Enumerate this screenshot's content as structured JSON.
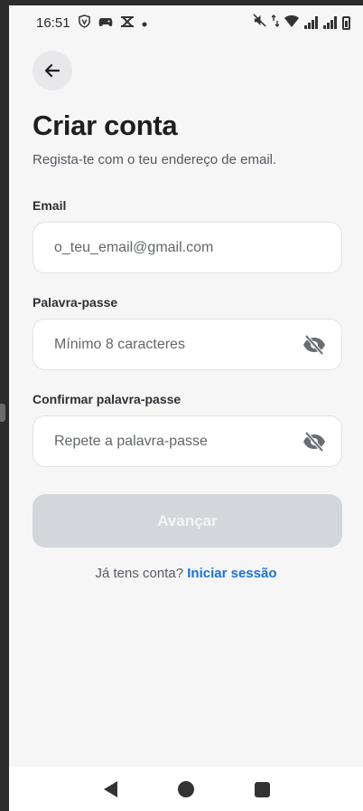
{
  "status_bar": {
    "time": "16:51",
    "left_icons": [
      "vpn-shield-icon",
      "game-controller-icon",
      "capcut-icon",
      "dot-icon"
    ],
    "right_icons": [
      "mute-icon",
      "wifi-icon",
      "signal-icon",
      "signal-icon",
      "battery-icon"
    ]
  },
  "header": {
    "back_icon": "arrow-left-icon",
    "title": "Criar conta",
    "subtitle": "Regista-te com o teu endereço de email."
  },
  "form": {
    "email": {
      "label": "Email",
      "placeholder": "o_teu_email@gmail.com",
      "value": ""
    },
    "password": {
      "label": "Palavra-passe",
      "placeholder": "Mínimo 8 caracteres",
      "value": "",
      "toggle_icon": "eye-off-icon"
    },
    "confirm_password": {
      "label": "Confirmar palavra-passe",
      "placeholder": "Repete a palavra-passe",
      "value": "",
      "toggle_icon": "eye-off-icon"
    },
    "submit_label": "Avançar",
    "submit_enabled": false
  },
  "footer": {
    "prompt": "Já tens conta?",
    "link": "Iniciar sessão"
  },
  "colors": {
    "accent": "#1a73d9",
    "button_disabled": "#d3d6db",
    "background": "#f6f6f7"
  },
  "nav_bar": {
    "icons": [
      "nav-back-icon",
      "nav-home-icon",
      "nav-recents-icon"
    ]
  }
}
